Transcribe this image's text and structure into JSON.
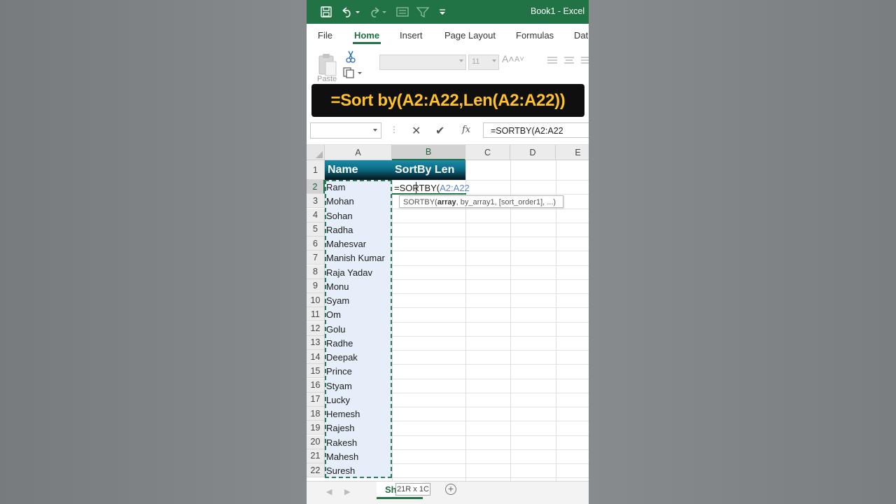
{
  "window": {
    "title": "Book1  -  Excel"
  },
  "ribbon": {
    "tabs": [
      "File",
      "Home",
      "Insert",
      "Page Layout",
      "Formulas",
      "Dat"
    ],
    "active_tab": "Home",
    "paste_label": "Paste",
    "font_size": "11",
    "grow_label": "A˄",
    "shrink_label": "A˅"
  },
  "banner": {
    "text": "=Sort by(A2:A22,Len(A2:A22))"
  },
  "formula_bar": {
    "name_box": "",
    "cancel_glyph": "✕",
    "enter_glyph": "✔",
    "fx_label": "fx",
    "formula": "=SORTBY(A2:A22"
  },
  "grid": {
    "columns": [
      "A",
      "B",
      "C",
      "D",
      "E"
    ],
    "selected_column": "B",
    "rows": [
      "1",
      "2",
      "3",
      "4",
      "5",
      "6",
      "7",
      "8",
      "9",
      "10",
      "11",
      "12",
      "13",
      "14",
      "15",
      "16",
      "17",
      "18",
      "19",
      "20",
      "21",
      "22"
    ],
    "selected_row": "2",
    "header_a": "Name",
    "header_b": "SortBy Len",
    "names": [
      "Ram",
      "Mohan",
      "Sohan",
      "Radha",
      "Mahesvar",
      "Manish Kumar",
      "Raja Yadav",
      "Monu",
      "Syam",
      "Om",
      "Golu",
      "Radhe",
      "Deepak",
      "Prince",
      "Styam",
      "Lucky",
      "Hemesh",
      "Rajesh",
      "Rakesh",
      "Mahesh",
      "Suresh"
    ],
    "editing_cell": {
      "prefix": "=SORTBY(",
      "ref": "A2:A22"
    },
    "tooltip": {
      "func": "SORTBY(",
      "arg1": "array",
      "rest": ", by_array1, [sort_order1], ...)"
    }
  },
  "sheets": {
    "tab_label": "Sh",
    "range_size_tip": "21R x 1C",
    "add_glyph": "+"
  },
  "colors": {
    "excel_green": "#217346",
    "banner_text": "#ffc12a",
    "header_fill": "#0b6c85",
    "selection_fill": "#e6eef9"
  }
}
